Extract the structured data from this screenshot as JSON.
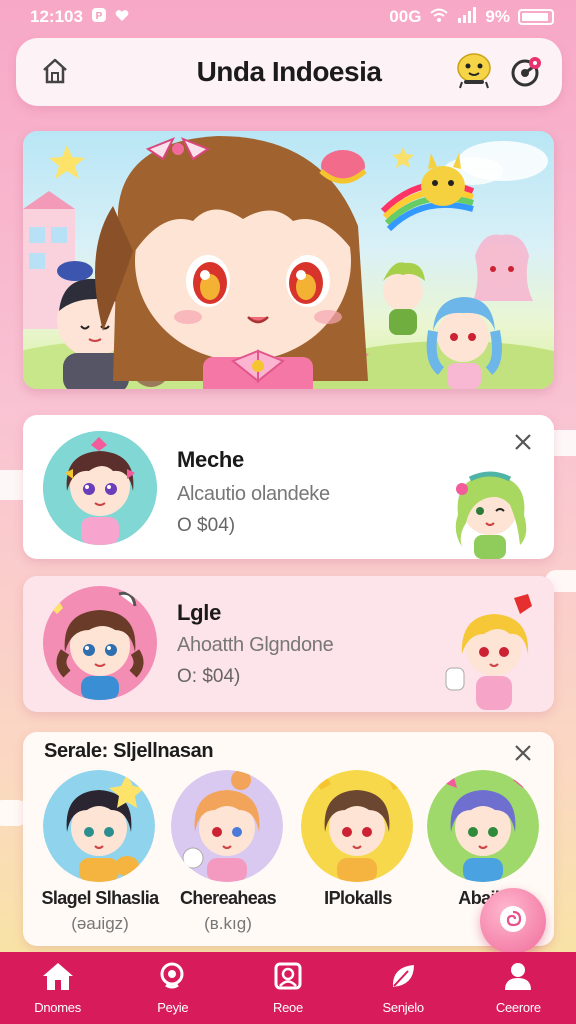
{
  "status_bar": {
    "time": "12:103",
    "right_text": "00G",
    "battery_text": "9%"
  },
  "header": {
    "title": "Unda Indoesia",
    "icons": [
      "home-icon",
      "mascot-icon",
      "notification-icon"
    ]
  },
  "banner": {
    "description_icon": "anime-banner"
  },
  "cards": [
    {
      "title": "Meche",
      "subtitle": "Alcautio olandeke",
      "price": "O $04)",
      "closable": true
    },
    {
      "title": "Lgle",
      "subtitle": "Ahoatth Glgndone",
      "price": "O: $04)",
      "closable": false
    }
  ],
  "characters_section": {
    "title": "Serale: Sljellnasan",
    "items": [
      {
        "name": "Slagel Slhaslia",
        "tag": "(əaɹigz)"
      },
      {
        "name": "Chereaheas",
        "tag": "(ʙ.kıg)"
      },
      {
        "name": "IPlokalls",
        "tag": ""
      },
      {
        "name": "Abaibl",
        "tag": ""
      }
    ]
  },
  "bottom_nav": [
    {
      "label": "Dnomes",
      "icon": "home-icon"
    },
    {
      "label": "Peyie",
      "icon": "search-icon"
    },
    {
      "label": "Reoe",
      "icon": "frame-icon"
    },
    {
      "label": "Senjelo",
      "icon": "leaf-icon"
    },
    {
      "label": "Ceerore",
      "icon": "profile-icon"
    }
  ],
  "colors": {
    "accent": "#d81b5a",
    "bg_top": "#f7a8c6",
    "bg_bottom": "#f7e79a"
  }
}
